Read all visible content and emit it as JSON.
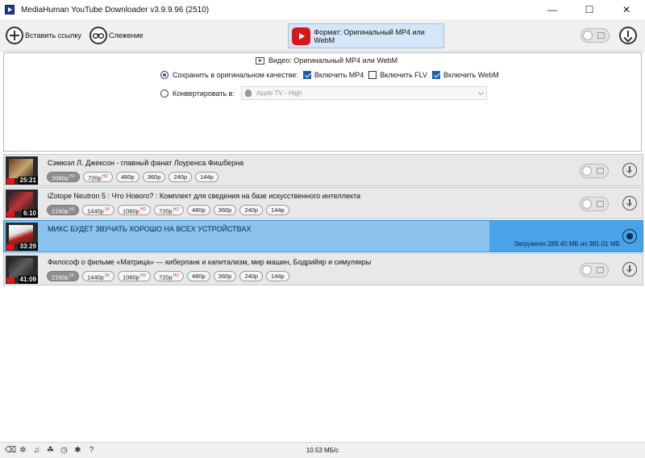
{
  "window": {
    "title": "MediaHuman YouTube Downloader v3.9.9.96 (2510)",
    "minimize": "—",
    "maximize": "☐",
    "close": "✕"
  },
  "toolbar": {
    "paste_label": "Вставить ссылку",
    "tracking_label": "Слежение",
    "format_label": "Формат: Оригинальный MP4 или WebM"
  },
  "settings": {
    "title": "Видео: Оригинальный MP4 или WebM",
    "keep_original_label": "Сохранить в оригинальном качестве:",
    "include_mp4": "Включить MP4",
    "include_flv": "Включить FLV",
    "include_webm": "Включить WebM",
    "convert_label": "Конвертировать в:",
    "convert_value": "Apple TV - High"
  },
  "items": [
    {
      "title": "Сэмюэл Л. Джексон - главный фанат Лоуренса Фишберна",
      "duration": "25:21",
      "chips": [
        {
          "label": "1080p",
          "badge": "HD",
          "selected": true
        },
        {
          "label": "720p",
          "badge": "HD",
          "selected": false
        },
        {
          "label": "480p",
          "badge": "",
          "selected": false
        },
        {
          "label": "360p",
          "badge": "",
          "selected": false
        },
        {
          "label": "240p",
          "badge": "",
          "selected": false
        },
        {
          "label": "144p",
          "badge": "",
          "selected": false
        }
      ]
    },
    {
      "title": "iZotope Neutron 5 : Что Нового? : Комплект для сведения на базе искусственного интеллекта",
      "duration": "6:10",
      "chips": [
        {
          "label": "2160p",
          "badge": "4K",
          "selected": true
        },
        {
          "label": "1440p",
          "badge": "2K",
          "selected": false
        },
        {
          "label": "1080p",
          "badge": "HD",
          "selected": false
        },
        {
          "label": "720p",
          "badge": "HD",
          "selected": false
        },
        {
          "label": "480p",
          "badge": "",
          "selected": false
        },
        {
          "label": "360p",
          "badge": "",
          "selected": false
        },
        {
          "label": "240p",
          "badge": "",
          "selected": false
        },
        {
          "label": "144p",
          "badge": "",
          "selected": false
        }
      ]
    },
    {
      "title": "МИКС БУДЕТ ЗВУЧАТЬ ХОРОШО НА ВСЕХ УСТРОЙСТВАХ",
      "duration": "33:29",
      "progress": 0.7595,
      "status": "Загружено 289.40 МБ из 381.01 МБ"
    },
    {
      "title": "Философ о фильме «Матрица» — киберпанк и капитализм, мир машин, Бодрийяр и симулякры",
      "duration": "41:09",
      "chips": [
        {
          "label": "2160p",
          "badge": "4K",
          "selected": true
        },
        {
          "label": "1440p",
          "badge": "2K",
          "selected": false
        },
        {
          "label": "1080p",
          "badge": "HD",
          "selected": false
        },
        {
          "label": "720p",
          "badge": "HD",
          "selected": false
        },
        {
          "label": "480p",
          "badge": "",
          "selected": false
        },
        {
          "label": "360p",
          "badge": "",
          "selected": false
        },
        {
          "label": "240p",
          "badge": "",
          "selected": false
        },
        {
          "label": "144p",
          "badge": "",
          "selected": false
        }
      ]
    }
  ],
  "statusbar": {
    "speed": "10.53 МБ/с",
    "icons": [
      "broom-icon",
      "gear-icon",
      "music-icon",
      "bird-icon",
      "clock-icon",
      "bug-icon",
      "help-icon"
    ]
  },
  "colors": {
    "accent": "#4aa3e8",
    "progress": "#8cc2ee",
    "youtube": "#d81818"
  }
}
